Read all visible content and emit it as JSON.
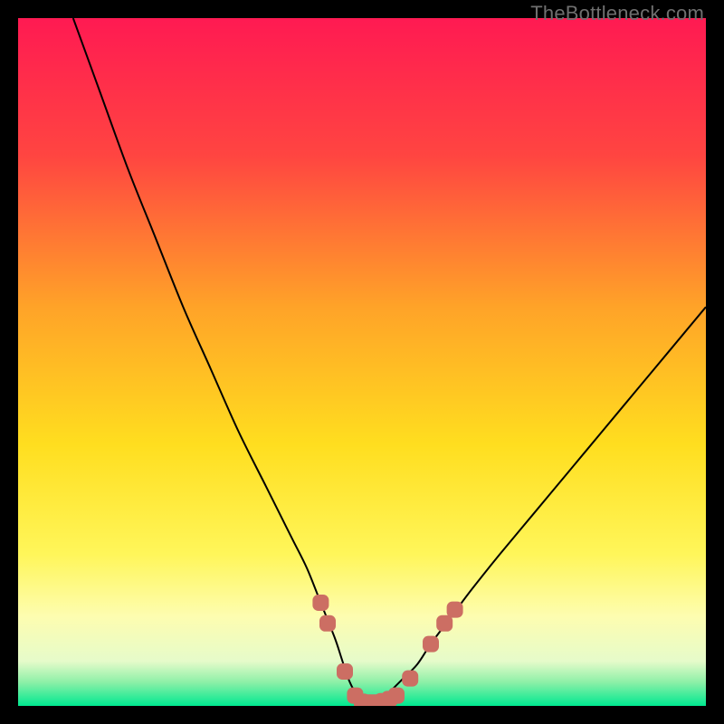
{
  "watermark": {
    "text": "TheBottleneck.com"
  },
  "chart_data": {
    "type": "line",
    "title": "",
    "subtitle": "",
    "xlabel": "",
    "ylabel": "",
    "xlim": [
      0,
      100
    ],
    "ylim": [
      0,
      100
    ],
    "grid": false,
    "legend": false,
    "background_gradient_stops": [
      {
        "offset": 0.0,
        "color": "#ff1a52"
      },
      {
        "offset": 0.2,
        "color": "#ff4541"
      },
      {
        "offset": 0.42,
        "color": "#ffa328"
      },
      {
        "offset": 0.62,
        "color": "#ffde1f"
      },
      {
        "offset": 0.78,
        "color": "#fff65a"
      },
      {
        "offset": 0.87,
        "color": "#fdfdb0"
      },
      {
        "offset": 0.935,
        "color": "#e6fbca"
      },
      {
        "offset": 0.965,
        "color": "#8ff0a8"
      },
      {
        "offset": 1.0,
        "color": "#00e890"
      }
    ],
    "series": [
      {
        "name": "bottleneck-curve",
        "color": "#000000",
        "width": 2,
        "x": [
          8,
          12,
          16,
          20,
          24,
          28,
          32,
          36,
          38,
          40,
          42,
          44,
          46,
          47,
          48,
          49,
          50,
          51,
          52,
          53,
          54,
          56,
          58,
          60,
          63,
          66,
          70,
          75,
          80,
          85,
          90,
          95,
          100
        ],
        "y": [
          100,
          89,
          78,
          68,
          58,
          49,
          40,
          32,
          28,
          24,
          20,
          15,
          10,
          7,
          4,
          2,
          1,
          0.5,
          0.5,
          1,
          2,
          4,
          6,
          9,
          13,
          17,
          22,
          28,
          34,
          40,
          46,
          52,
          58
        ]
      },
      {
        "name": "highlight-markers",
        "color": "#cc6e63",
        "marker_size": 9,
        "points": [
          {
            "x": 44.0,
            "y": 15.0
          },
          {
            "x": 45.0,
            "y": 12.0
          },
          {
            "x": 47.5,
            "y": 5.0
          },
          {
            "x": 49.0,
            "y": 1.5
          },
          {
            "x": 50.0,
            "y": 0.6
          },
          {
            "x": 51.0,
            "y": 0.5
          },
          {
            "x": 52.0,
            "y": 0.5
          },
          {
            "x": 53.0,
            "y": 0.7
          },
          {
            "x": 54.0,
            "y": 1.0
          },
          {
            "x": 55.0,
            "y": 1.5
          },
          {
            "x": 57.0,
            "y": 4.0
          },
          {
            "x": 60.0,
            "y": 9.0
          },
          {
            "x": 62.0,
            "y": 12.0
          },
          {
            "x": 63.5,
            "y": 14.0
          }
        ]
      }
    ]
  }
}
